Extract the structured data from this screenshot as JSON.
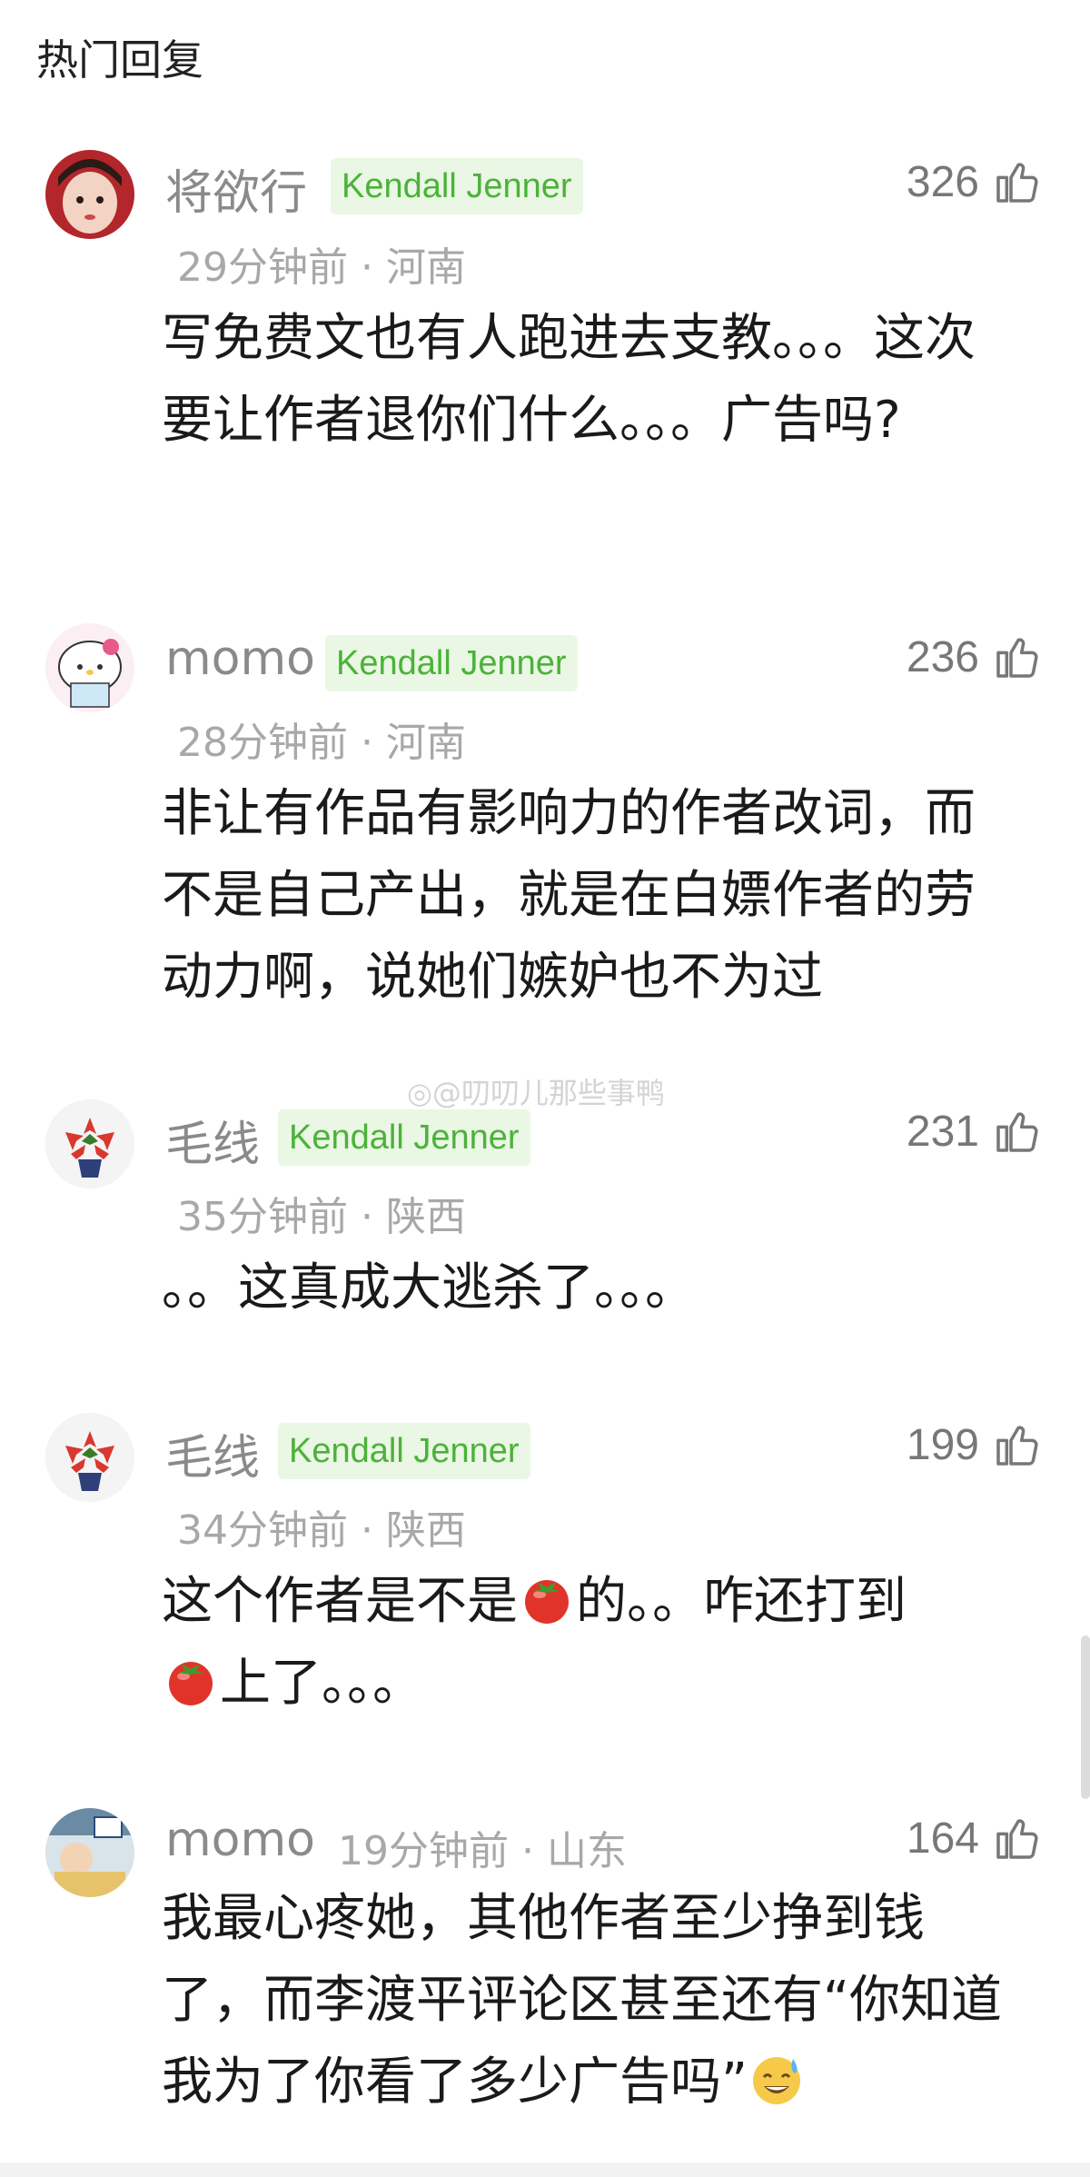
{
  "section": {
    "title": "热门回复"
  },
  "watermark": "◎@叨叨儿那些事鸭",
  "colors": {
    "badge_bg": "#eaf7e4",
    "badge_text": "#4cb23a",
    "meta": "#a8a8a8",
    "name": "#8a8a8a"
  },
  "comments": [
    {
      "name": "将欲行",
      "badge": "Kendall Jenner",
      "time_location": "29分钟前 · 河南",
      "likes": "326",
      "like_icon": "thumbs-up-icon",
      "text": "写免费文也有人跑进去支教。。。这次要让作者退你们什么。。。广告吗?"
    },
    {
      "name": "momo",
      "badge": "Kendall Jenner",
      "time_location": "28分钟前 · 河南",
      "likes": "236",
      "like_icon": "thumbs-up-icon",
      "text": "非让有作品有影响力的作者改词，而不是自己产出，就是在白嫖作者的劳动力啊，说她们嫉妒也不为过"
    },
    {
      "name": "毛线",
      "badge": "Kendall Jenner",
      "time_location": "35分钟前 · 陕西",
      "likes": "231",
      "like_icon": "thumbs-up-icon",
      "text": "。。这真成大逃杀了。。。"
    },
    {
      "name": "毛线",
      "badge": "Kendall Jenner",
      "time_location": "34分钟前 · 陕西",
      "likes": "199",
      "like_icon": "thumbs-up-icon",
      "text_a": "这个作者是不是",
      "text_b": "的。。咋还打到",
      "text_c": "上了。。。",
      "emoji": "tomato-emoji"
    },
    {
      "name": "momo",
      "time_location": "19分钟前 · 山东",
      "likes": "164",
      "like_icon": "thumbs-up-icon",
      "text": "我最心疼她，其他作者至少挣到钱了，而李渡平评论区甚至还有“你知道我为了你看了多少广告吗”",
      "emoji": "sweat-smile-emoji"
    }
  ]
}
